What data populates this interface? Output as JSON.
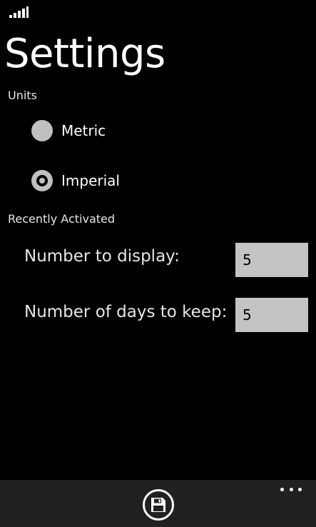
{
  "status_bar": {
    "signal_icon": "signal-strength-icon"
  },
  "page": {
    "title": "Settings"
  },
  "units": {
    "section_label": "Units",
    "options": [
      {
        "label": "Metric",
        "checked": false
      },
      {
        "label": "Imperial",
        "checked": true
      }
    ]
  },
  "recently_activated": {
    "section_label": "Recently Activated",
    "number_to_display": {
      "label": "Number to display:",
      "value": "5"
    },
    "days_to_keep": {
      "label": "Number of days to keep:",
      "value": "5"
    }
  },
  "app_bar": {
    "save_icon": "save-icon",
    "more_icon": "more-ellipsis-icon"
  },
  "colors": {
    "background": "#000000",
    "app_bar": "#212121",
    "radio": "#c0c0c0",
    "input_background": "#c4c4c4",
    "text": "#ffffff"
  }
}
